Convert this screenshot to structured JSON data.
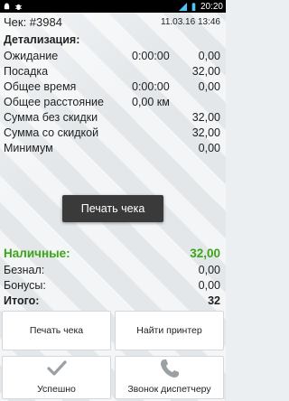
{
  "status_bar": {
    "time": "20:20"
  },
  "receipt": {
    "check_label": "Чек: #3984",
    "date": "11.03.16 13:46",
    "details_title": "Детализация:",
    "rows": [
      {
        "label": "Ожидание",
        "mid": "0:00:00",
        "value": "0,00"
      },
      {
        "label": "Посадка",
        "mid": "",
        "value": "32,00"
      },
      {
        "label": "Общее время",
        "mid": "0:00:00",
        "value": "0,00"
      },
      {
        "label": "Общее расстояние",
        "mid": "0,00 км",
        "value": ""
      },
      {
        "label": "Сумма без скидки",
        "mid": "",
        "value": "32,00"
      },
      {
        "label": "Сумма со скидкой",
        "mid": "",
        "value": "32,00"
      },
      {
        "label": "Минимум",
        "mid": "",
        "value": "0,00"
      }
    ]
  },
  "toast": {
    "text": "Печать чека"
  },
  "payment": {
    "cash_label": "Наличные:",
    "cash_value": "32,00",
    "card_label": "Безнал:",
    "card_value": "0,00",
    "bonus_label": "Бонусы:",
    "bonus_value": "0,00",
    "total_label": "Итого:",
    "total_value": "32"
  },
  "buttons": {
    "print_receipt": "Печать чека",
    "find_printer": "Найти принтер",
    "success": "Успешно",
    "call_dispatcher": "Звонок диспетчеру"
  },
  "colors": {
    "cash_green": "#3aa616",
    "toast_bg": "#3a3a3a"
  },
  "icons": {
    "statusbar_left": [
      "android-icon",
      "bug-icon"
    ],
    "statusbar_right": [
      "signal-icon",
      "battery-icon"
    ],
    "success_button": "check-icon",
    "call_button": "phone-icon"
  }
}
